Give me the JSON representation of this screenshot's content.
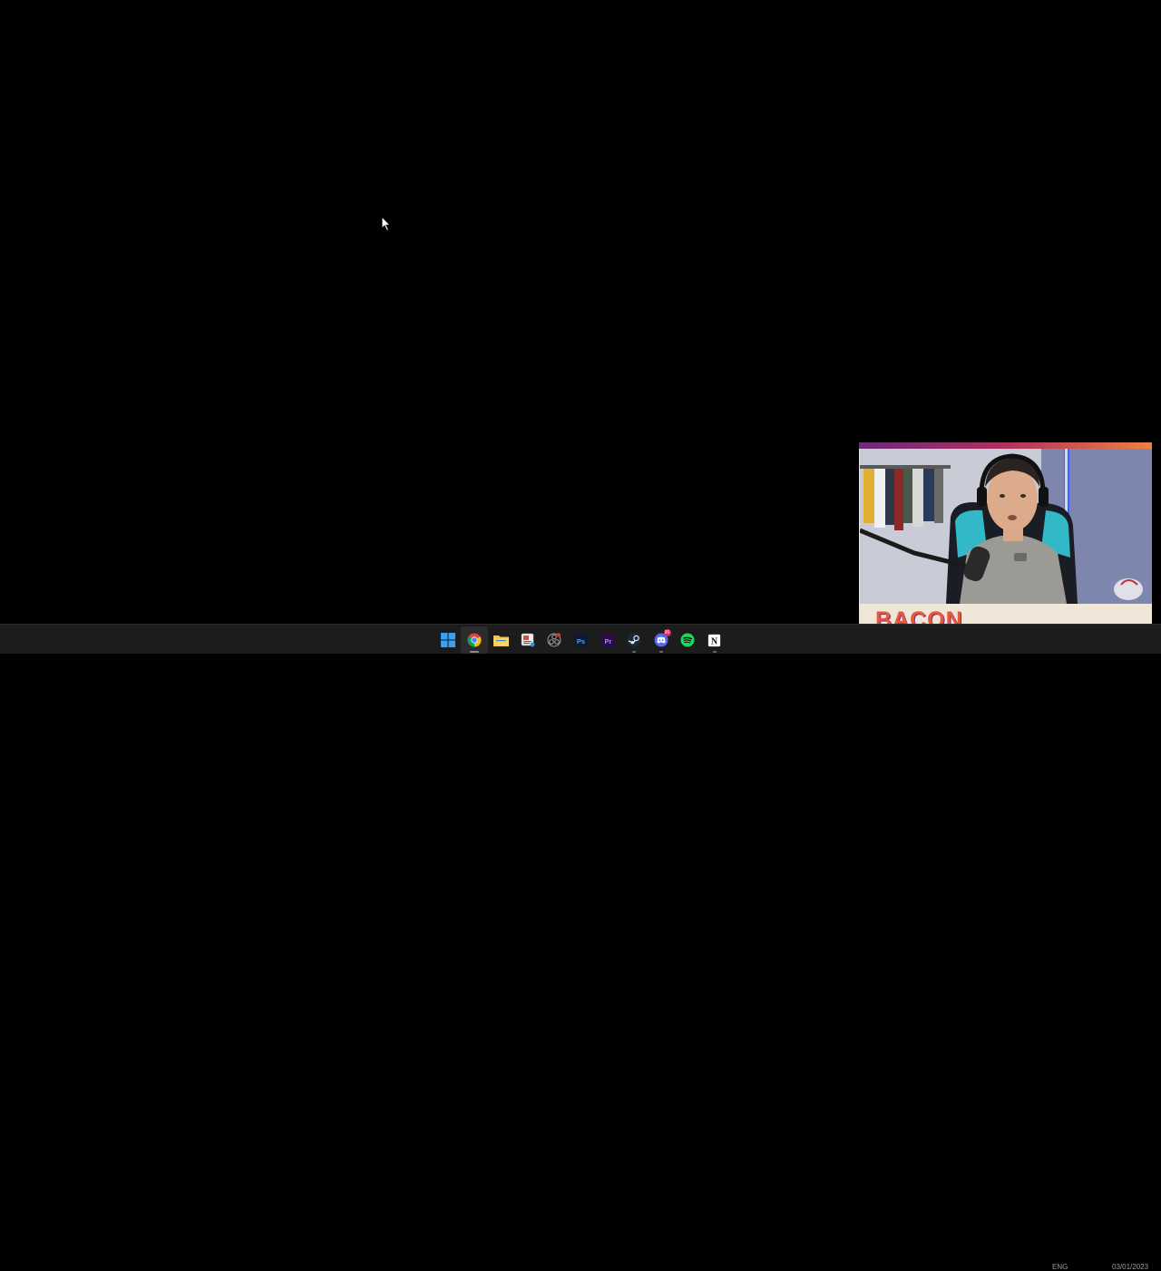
{
  "desktop": {
    "background_color": "#000000"
  },
  "taskbar": {
    "background_color": "#1c1c1c",
    "apps": [
      {
        "name": "start",
        "icon": "windows-start-icon"
      },
      {
        "name": "chrome",
        "icon": "chrome-icon",
        "state": "active"
      },
      {
        "name": "file-explorer",
        "icon": "folder-icon"
      },
      {
        "name": "snipping-tool",
        "icon": "snipping-tool-icon"
      },
      {
        "name": "davinci",
        "icon": "davinci-resolve-icon"
      },
      {
        "name": "photoshop",
        "icon": "photoshop-icon",
        "label": "Ps"
      },
      {
        "name": "premiere",
        "icon": "premiere-pro-icon",
        "label": "Pr"
      },
      {
        "name": "steam",
        "icon": "steam-icon",
        "state": "running"
      },
      {
        "name": "discord",
        "icon": "discord-icon",
        "state": "running",
        "badge": "99"
      },
      {
        "name": "spotify",
        "icon": "spotify-icon"
      },
      {
        "name": "notion",
        "icon": "notion-icon",
        "label": "N",
        "state": "running"
      }
    ],
    "tray": {
      "lang": "ENG",
      "date": "03/01/2023"
    }
  },
  "webcam_overlay": {
    "name_label": "BACON",
    "accent_colors": [
      "#6a2a7a",
      "#b03060",
      "#f08040"
    ],
    "label_color": "#e8573a"
  }
}
